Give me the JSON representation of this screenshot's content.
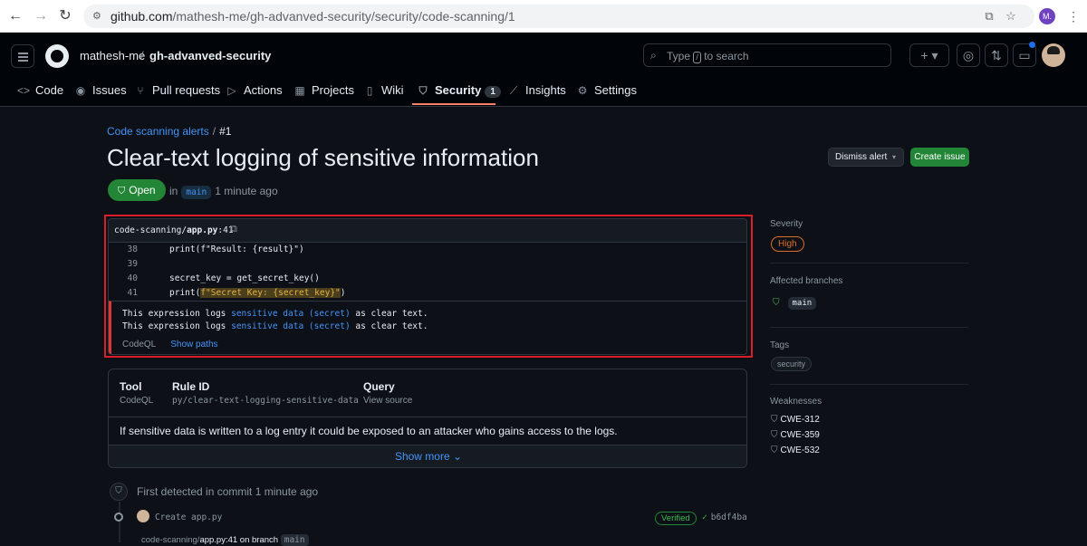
{
  "browser": {
    "url_host": "github.com",
    "url_path": "/mathesh-me/gh-advanved-security/security/code-scanning/1",
    "profile_initial": "M."
  },
  "header": {
    "owner": "mathesh-me",
    "separator": "/",
    "repo": "gh-advanved-security",
    "search_placeholder_pre": "Type",
    "search_slash": "/",
    "search_placeholder_post": "to search"
  },
  "tabs": [
    {
      "label": "Code",
      "icon": "code-icon"
    },
    {
      "label": "Issues",
      "icon": "issue-icon"
    },
    {
      "label": "Pull requests",
      "icon": "pull-request-icon"
    },
    {
      "label": "Actions",
      "icon": "play-icon"
    },
    {
      "label": "Projects",
      "icon": "table-icon"
    },
    {
      "label": "Wiki",
      "icon": "book-icon"
    },
    {
      "label": "Security",
      "icon": "shield-icon",
      "count": "1"
    },
    {
      "label": "Insights",
      "icon": "graph-icon"
    },
    {
      "label": "Settings",
      "icon": "gear-icon"
    }
  ],
  "page": {
    "breadcrumb_link": "Code scanning alerts",
    "breadcrumb_sep": "/",
    "breadcrumb_current": "#1",
    "title": "Clear-text logging of sensitive information",
    "status": "Open",
    "meta_in": "in",
    "meta_branch": "main",
    "meta_time": "1 minute ago",
    "dismiss_label": "Dismiss alert",
    "create_issue_label": "Create issue"
  },
  "code": {
    "path_prefix": "code-scanning/",
    "path_file": "app.py",
    "path_line": ":41",
    "lines": [
      {
        "n": "38",
        "text": "print(f\"Result: {result}\")"
      },
      {
        "n": "39",
        "text": ""
      },
      {
        "n": "40",
        "text": "secret_key = get_secret_key()"
      },
      {
        "n": "41",
        "pre": "print(",
        "hl": "f\"Secret Key: {secret_key}\"",
        "post": ")"
      }
    ],
    "message_pre": "This expression logs ",
    "message_link": "sensitive data (secret)",
    "message_post": " as clear text.",
    "tool": "CodeQL",
    "show_paths": "Show paths"
  },
  "info": {
    "tool_h": "Tool",
    "tool_v": "CodeQL",
    "rule_h": "Rule ID",
    "rule_v": "py/clear-text-logging-sensitive-data",
    "query_h": "Query",
    "query_v": "View source",
    "description": "If sensitive data is written to a log entry it could be exposed to an attacker who gains access to the logs.",
    "show_more": "Show more"
  },
  "sidebar": {
    "severity_h": "Severity",
    "severity_v": "High",
    "branches_h": "Affected branches",
    "branch": "main",
    "tags_h": "Tags",
    "tag": "security",
    "weaknesses_h": "Weaknesses",
    "weaknesses": [
      "CWE-312",
      "CWE-359",
      "CWE-532"
    ]
  },
  "timeline": {
    "first_detected": "First detected in commit 1 minute ago",
    "commit_msg": "Create app.py",
    "verified": "Verified",
    "sha": "b6df4ba",
    "loc_prefix": "code-scanning/",
    "loc_file": "app.py:41",
    "loc_mid": " on branch ",
    "loc_branch": "main"
  },
  "colors": {
    "accent_blue": "#4493f8",
    "open_green": "#238636",
    "severity_high": "#db6d28",
    "highlight_outline": "#da1e28"
  }
}
